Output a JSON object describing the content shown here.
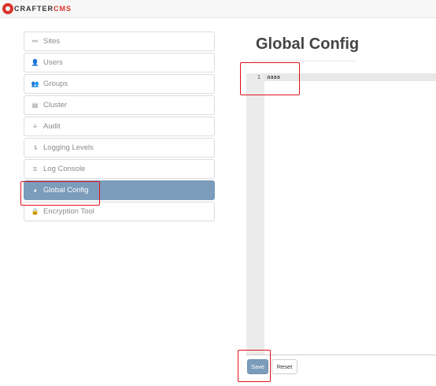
{
  "brand": {
    "part1": "CRAFTER",
    "part2": "CMS",
    "accent": "#d9342b"
  },
  "sidebar": {
    "items": [
      {
        "label": "Sites",
        "icon": "sitemap-icon",
        "glyph": "⚯",
        "active": false
      },
      {
        "label": "Users",
        "icon": "user-icon",
        "glyph": "👤",
        "active": false
      },
      {
        "label": "Groups",
        "icon": "users-icon",
        "glyph": "👥",
        "active": false
      },
      {
        "label": "Cluster",
        "icon": "database-icon",
        "glyph": "▤",
        "active": false
      },
      {
        "label": "Audit",
        "icon": "list-icon",
        "glyph": "≡",
        "active": false
      },
      {
        "label": "Logging Levels",
        "icon": "level-down-icon",
        "glyph": "↴",
        "active": false
      },
      {
        "label": "Log Console",
        "icon": "console-icon",
        "glyph": "≣",
        "active": false
      },
      {
        "label": "Global Config",
        "icon": "globe-icon",
        "glyph": "◕",
        "active": true
      },
      {
        "label": "Encryption Tool",
        "icon": "lock-icon",
        "glyph": "🔒",
        "active": false
      }
    ],
    "active_color": "#7b9cbb"
  },
  "main": {
    "title": "Global Config",
    "editor": {
      "line_number": "1",
      "content": "aaaa"
    },
    "buttons": {
      "save": "Save",
      "reset": "Reset"
    }
  },
  "highlight_color": "#e0121a"
}
